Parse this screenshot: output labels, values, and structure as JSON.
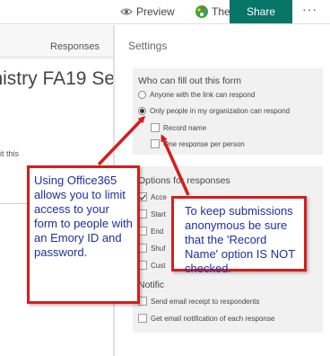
{
  "topbar": {
    "preview_label": "Preview",
    "theme_label": "Theme",
    "share_label": "Share",
    "more_label": "···"
  },
  "left": {
    "tab_responses": "Responses",
    "form_title": "nistry FA19 Se",
    "snippet": "it this"
  },
  "settings": {
    "title": "Settings",
    "who_group": {
      "title": "Who can fill out this form",
      "anyone": "Anyone with the link can respond",
      "org_only": "Only people in my organization can respond",
      "record_name": "Record name",
      "one_response": "One response per person"
    },
    "options_group": {
      "title": "Options for responses",
      "item1": "Acce",
      "item2": "Start",
      "item3": "End",
      "item4": "Shuf",
      "item5": "Cust"
    },
    "notif_group": {
      "title": "Notific",
      "email_receipt": "Send email receipt to respondents",
      "email_notif": "Get email notification of each response"
    }
  },
  "callouts": {
    "office365": "Using Office365 allows you to limit access to your form to people with an Emory ID and password.",
    "record_name": "To keep submissions anonymous be sure that the 'Record Name' option IS NOT checked."
  },
  "colors": {
    "share_bg": "#077568",
    "callout_border": "#d41e1e",
    "callout_text": "#1f2fa0",
    "arrow": "#d41e1e"
  }
}
